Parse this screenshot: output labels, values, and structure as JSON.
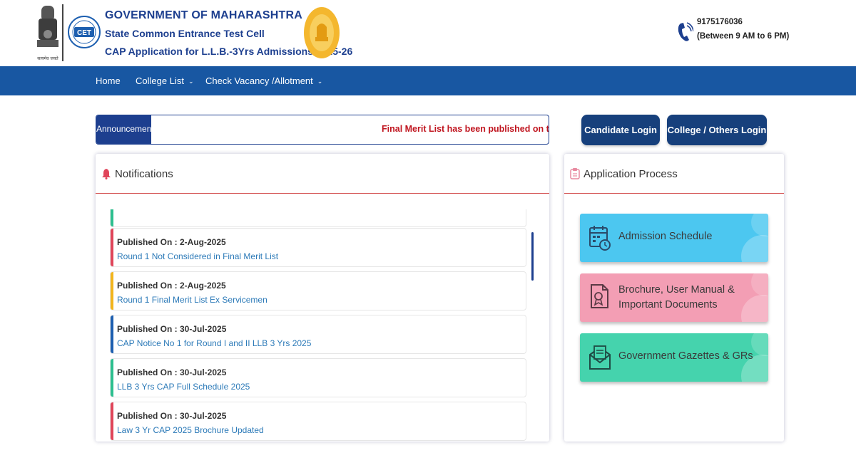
{
  "header": {
    "emblem_caption": "सत्यमेव जयते",
    "title": "GOVERNMENT OF MAHARASHTRA",
    "subtitle": "State Common Entrance Test Cell",
    "application": "CAP Application for L.L.B.-3Yrs Admissions 2025-26",
    "cet_logo_text": "CET",
    "phone": "9175176036",
    "phone_hours": "(Between 9 AM to 6 PM)"
  },
  "nav": {
    "items": [
      {
        "label": "Home"
      },
      {
        "label": "College List"
      },
      {
        "label": "Check Vacancy /Allotment"
      }
    ]
  },
  "announcement": {
    "label": "Announcement",
    "text": "Final Merit List has been published on the Webs"
  },
  "buttons": {
    "candidate_login": "Candidate Login",
    "college_login": "College / Others Login"
  },
  "notifications": {
    "title": "Notifications",
    "items": [
      {
        "published": "Published On : 2-Aug-2025",
        "title": "Round 1 Not Considered in Final Merit List",
        "color": "#e0455a"
      },
      {
        "published": "Published On : 2-Aug-2025",
        "title": "Round 1 Final Merit List Ex Servicemen",
        "color": "#f2b51d"
      },
      {
        "published": "Published On : 30-Jul-2025",
        "title": "CAP Notice No 1 for Round I and II LLB 3 Yrs 2025",
        "color": "#1d5fb0"
      },
      {
        "published": "Published On : 30-Jul-2025",
        "title": "LLB 3 Yrs CAP Full Schedule 2025",
        "color": "#2dbf8f"
      },
      {
        "published": "Published On : 30-Jul-2025",
        "title": "Law 3 Yr CAP 2025 Brochure Updated",
        "color": "#e0455a"
      }
    ]
  },
  "process": {
    "title": "Application Process",
    "items": [
      {
        "label": "Admission Schedule",
        "color": "#4cc7f0",
        "icon": "calendar-icon"
      },
      {
        "label": "Brochure, User Manual & Important Documents",
        "color": "#f39eb4",
        "icon": "document-icon"
      },
      {
        "label": "Government Gazettes & GRs",
        "color": "#45d3ad",
        "icon": "envelope-icon"
      }
    ]
  }
}
